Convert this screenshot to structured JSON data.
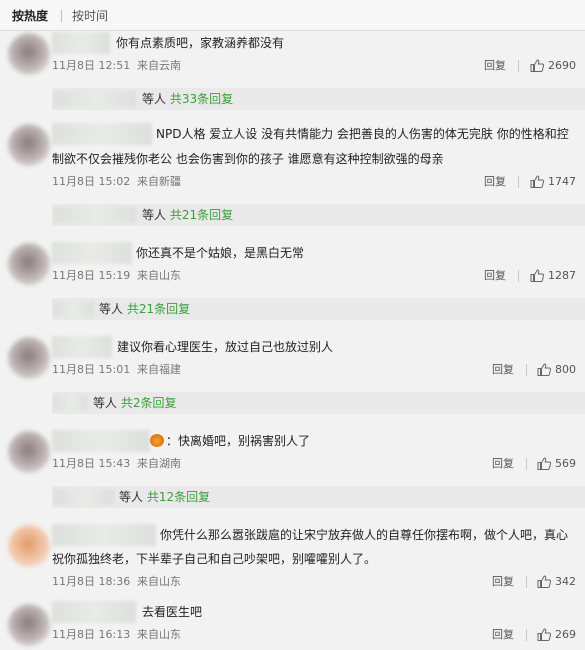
{
  "sort": {
    "tabs": [
      {
        "label": "按热度",
        "active": true
      },
      {
        "label": "按时间",
        "active": false
      }
    ]
  },
  "comments": [
    {
      "text_lines": [
        "你有点素质吧，家教涵养都没有"
      ],
      "date": "11月8日 12:51",
      "source": "来自云南",
      "reply": "回复",
      "likes": "2690",
      "sub": {
        "prefix": "等人",
        "link": "共33条回复"
      }
    },
    {
      "text_lines": [
        "NPD人格 爱立人设 没有共情能力 会把善良的人伤害的体无完肤 你的性格和控",
        "制欲不仅会摧残你老公 也会伤害到你的孩子 谁愿意有这种控制欲强的母亲"
      ],
      "date": "11月8日 15:02",
      "source": "来自新疆",
      "reply": "回复",
      "likes": "1747",
      "sub": {
        "prefix": "等人",
        "link": "共21条回复"
      }
    },
    {
      "text_lines": [
        "你还真不是个姑娘，是黑白无常"
      ],
      "date": "11月8日 15:19",
      "source": "来自山东",
      "reply": "回复",
      "likes": "1287",
      "sub": {
        "prefix": "等人",
        "link": "共21条回复"
      }
    },
    {
      "text_lines": [
        "建议你看心理医生，放过自己也放过别人"
      ],
      "date": "11月8日 15:01",
      "source": "来自福建",
      "reply": "回复",
      "likes": "800",
      "sub": {
        "prefix": "等人",
        "link": "共2条回复"
      }
    },
    {
      "text_lines": [
        "：快离婚吧，别祸害别人了"
      ],
      "date": "11月8日 15:43",
      "source": "来自湖南",
      "reply": "回复",
      "likes": "569",
      "sub": {
        "prefix": "等人",
        "link": "共12条回复"
      }
    },
    {
      "text_lines": [
        "你凭什么那么嚣张跋扈的让宋宁放弃做人的自尊任你摆布啊，做个人吧，真心",
        "祝你孤独终老，下半辈子自己和自己吵架吧，别嚯嚯别人了。"
      ],
      "date": "11月8日 18:36",
      "source": "来自山东",
      "reply": "回复",
      "likes": "342"
    },
    {
      "text_lines": [
        "去看医生吧"
      ],
      "date": "11月8日 16:13",
      "source": "来自山东",
      "reply": "回复",
      "likes": "269"
    }
  ],
  "colors": {
    "link": "#3c9d3c",
    "background": "#f2f2f2"
  }
}
